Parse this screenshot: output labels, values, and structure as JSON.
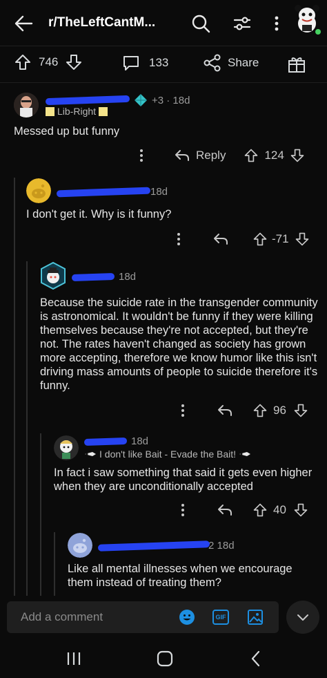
{
  "header": {
    "subreddit": "r/TheLeftCantM...",
    "icons": [
      "back-arrow-icon",
      "search-icon",
      "sort-icon",
      "more-icon",
      "profile-avatar"
    ]
  },
  "post_actions": {
    "upvotes": "746",
    "comments": "133",
    "share_label": "Share"
  },
  "comments": [
    {
      "meta_extra": "+3 · 18d",
      "flair": "Lib-Right",
      "body": "Messed up but funny",
      "reply_label": "Reply",
      "score": "124"
    },
    {
      "time": "18d",
      "body": "I don't get it. Why is it funny?",
      "score": "-71"
    },
    {
      "time": "18d",
      "body": "Because the suicide rate in the transgender community is astronomical. It wouldn't be funny if they were killing themselves because they're not accepted, but they're not. The rates haven't changed as society has grown more accepting, therefore we know humor like this isn't driving mass amounts of people to suicide therefore it's funny.",
      "score": "96"
    },
    {
      "time": "18d",
      "flair": "I don't like Bait - Evade the Bait!",
      "body": "In fact i saw something that said it gets even higher when they are unconditionally accepted",
      "score": "40"
    },
    {
      "time": "2 18d",
      "body": "Like all mental illnesses when we encourage them instead of treating them?"
    }
  ],
  "composer": {
    "placeholder": "Add a comment",
    "gif_label": "GIF"
  },
  "colors": {
    "background": "#0b0b0b",
    "redaction_blue": "#2643f2",
    "emoji_blue": "#1d8fe1",
    "thread_line": "#2e2e2e"
  }
}
